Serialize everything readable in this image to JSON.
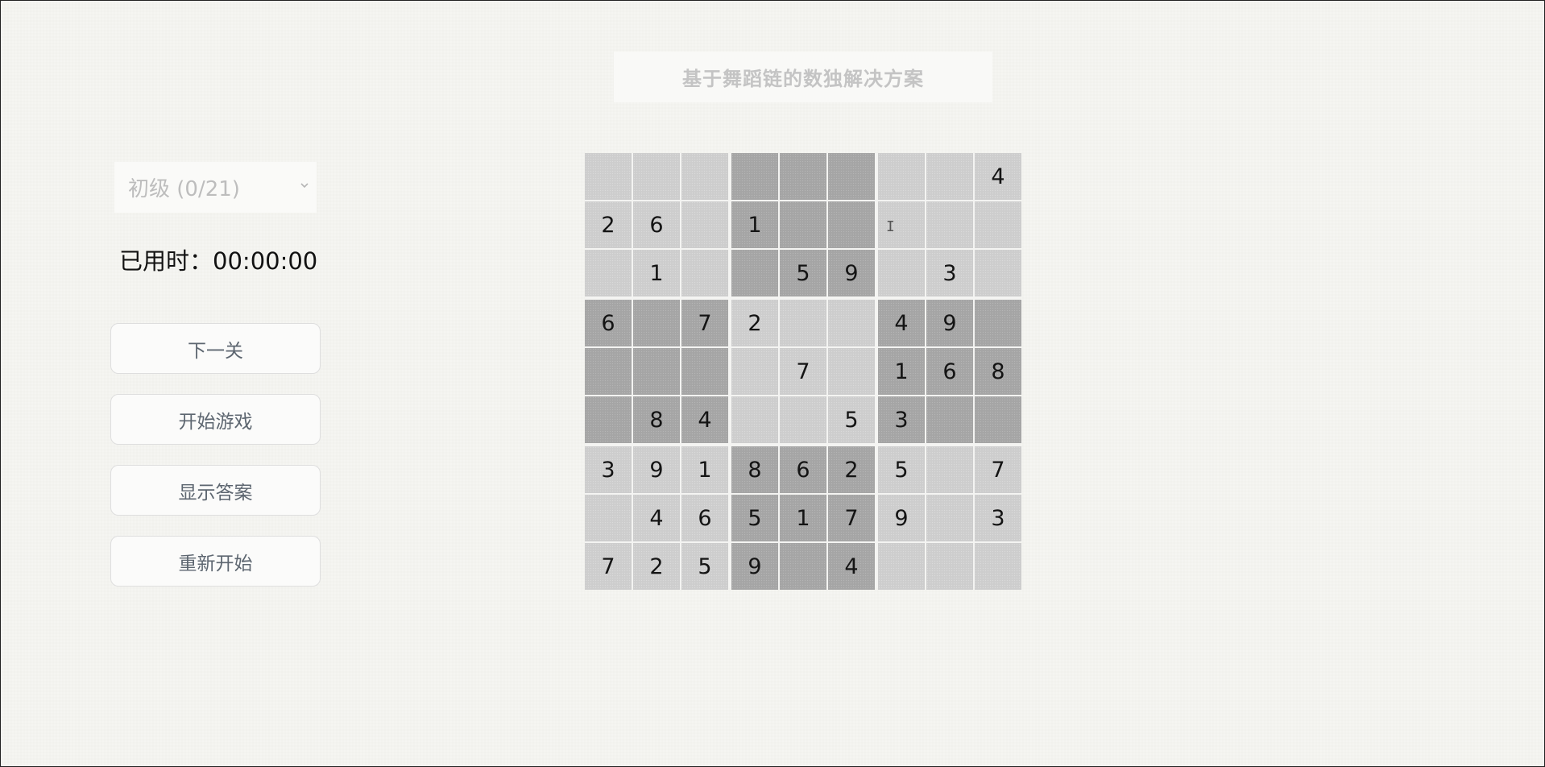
{
  "title": "基于舞蹈链的数独解决方案",
  "level_select": {
    "selected": "初级 (0/21)"
  },
  "timer": {
    "label": "已用时：",
    "value": "00:00:00"
  },
  "buttons": {
    "next": "下一关",
    "start": "开始游戏",
    "answer": "显示答案",
    "restart": "重新开始"
  },
  "board": [
    [
      "",
      "",
      "",
      "",
      "",
      "",
      "",
      "",
      "4"
    ],
    [
      "2",
      "6",
      "",
      "1",
      "",
      "",
      "",
      "",
      ""
    ],
    [
      "",
      "1",
      "",
      "",
      "5",
      "9",
      "",
      "3",
      ""
    ],
    [
      "6",
      "",
      "7",
      "2",
      "",
      "",
      "4",
      "9",
      ""
    ],
    [
      "",
      "",
      "",
      "",
      "7",
      "",
      "1",
      "6",
      "8"
    ],
    [
      "",
      "8",
      "4",
      "",
      "",
      "5",
      "3",
      "",
      ""
    ],
    [
      "3",
      "9",
      "1",
      "8",
      "6",
      "2",
      "5",
      "",
      "7"
    ],
    [
      "",
      "4",
      "6",
      "5",
      "1",
      "7",
      "9",
      "",
      "3"
    ],
    [
      "7",
      "2",
      "5",
      "9",
      "",
      "4",
      "",
      "",
      ""
    ]
  ],
  "colors": {
    "light_cell": "#cdcdcd",
    "dark_cell": "#a5a5a5",
    "background": "#f3f3ef",
    "title_text": "#c4c4c4"
  },
  "icons": {
    "select_arrow": "chevron-down-icon",
    "cursor": "text-cursor-icon"
  }
}
